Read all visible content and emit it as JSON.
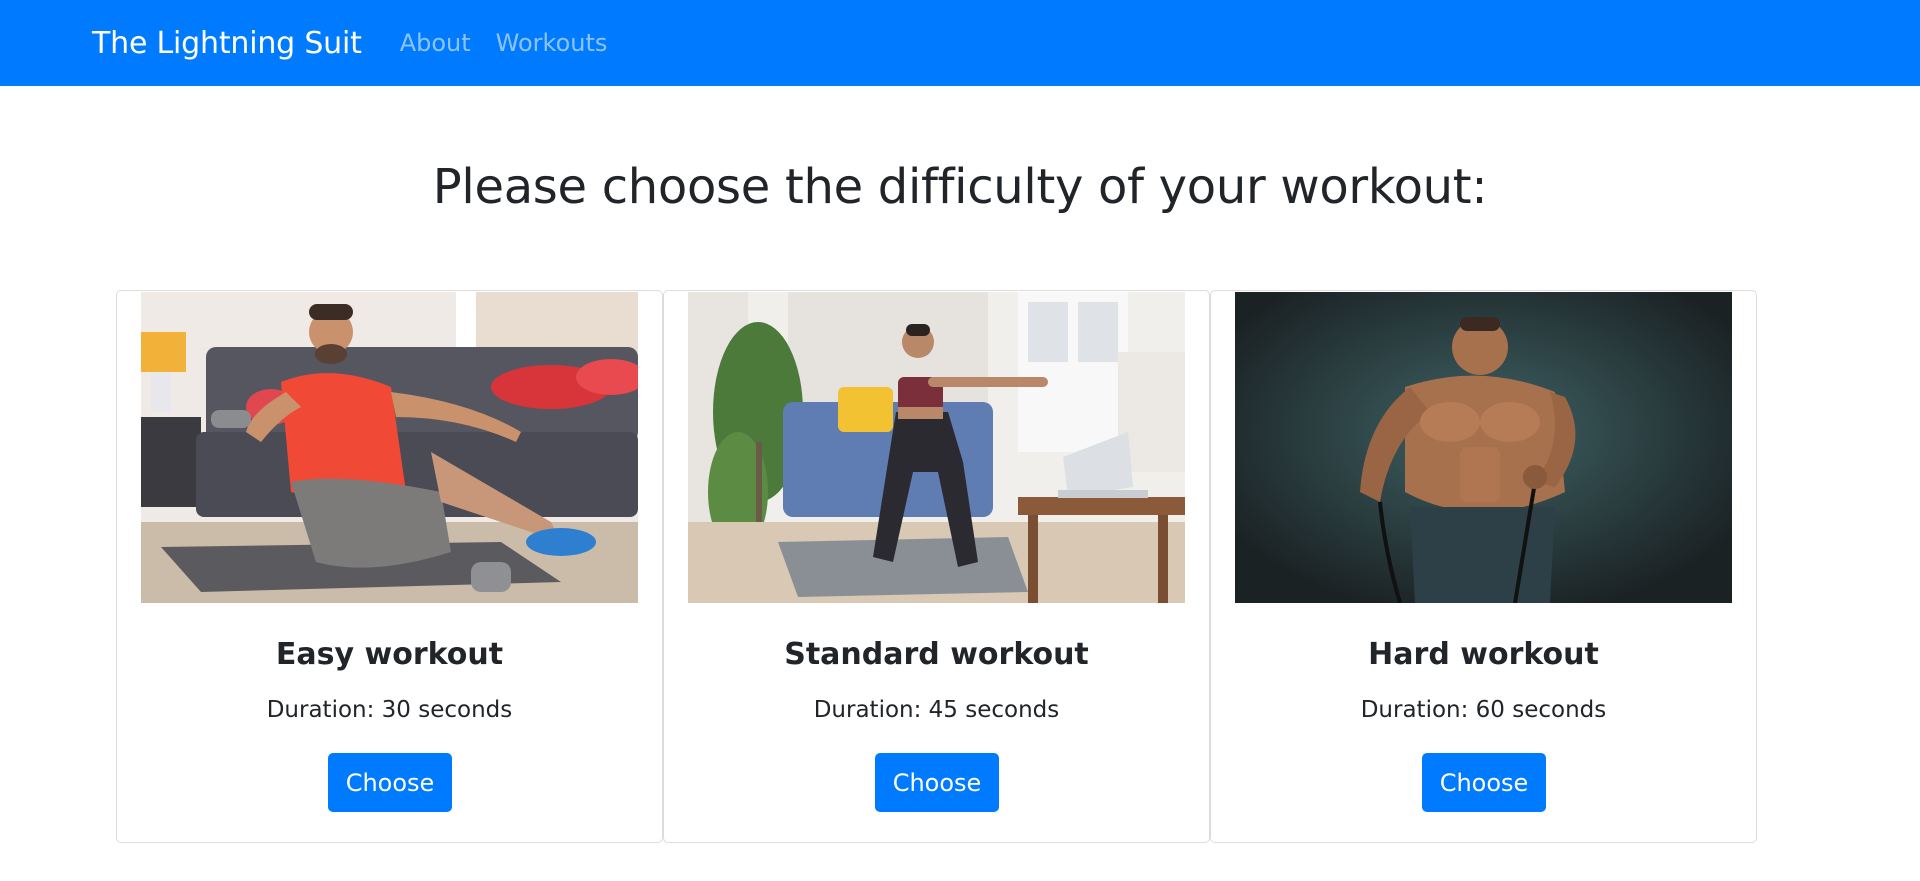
{
  "navbar": {
    "brand": "The Lightning Suit",
    "links": [
      "About",
      "Workouts"
    ],
    "background": "#007bff"
  },
  "main": {
    "heading": "Please choose the difficulty of your workout:"
  },
  "cards": [
    {
      "image": "man-exercising-with-dumbbell-photo",
      "title": "Easy workout",
      "duration": "Duration: 30 seconds",
      "button_label": "Choose"
    },
    {
      "image": "woman-doing-squat-photo",
      "title": "Standard workout",
      "duration": "Duration: 45 seconds",
      "button_label": "Choose"
    },
    {
      "image": "muscular-man-with-resistance-band-photo",
      "title": "Hard workout",
      "duration": "Duration: 60 seconds",
      "button_label": "Choose"
    }
  ],
  "colors": {
    "accent": "#007bff",
    "text": "#212529",
    "nav_link_muted": "rgba(255,255,255,0.55)"
  }
}
